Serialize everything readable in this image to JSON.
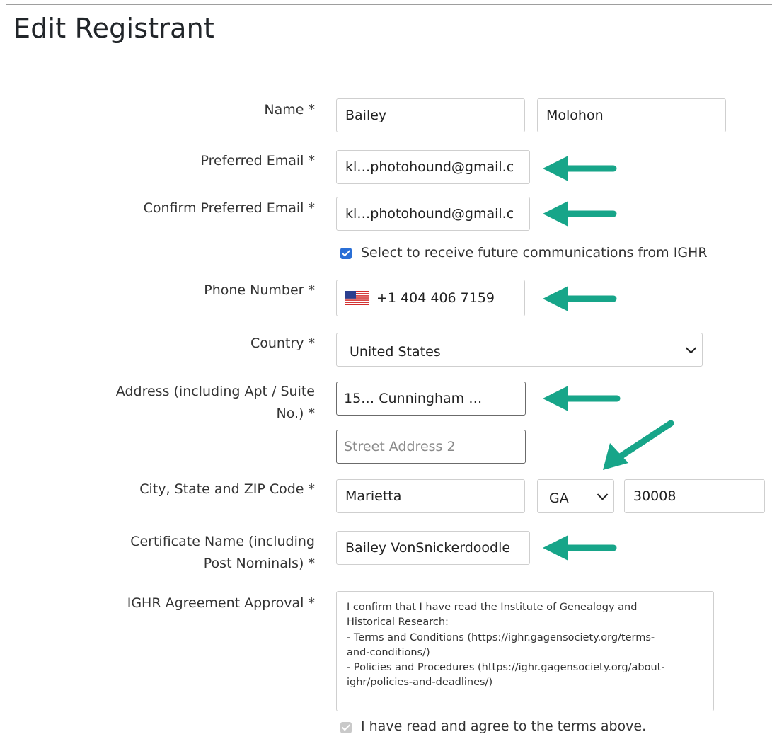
{
  "page": {
    "title": "Edit Registrant"
  },
  "form": {
    "name": {
      "label": "Name  *",
      "first_value": "Bailey",
      "last_value": "Molohon"
    },
    "preferred_email": {
      "label": "Preferred Email  *",
      "value": "kl…photohound@gmail.c"
    },
    "confirm_email": {
      "label": "Confirm Preferred Email  *",
      "value": "kl…photohound@gmail.c"
    },
    "communications": {
      "label": "Select to receive future communications from IGHR",
      "checked": true
    },
    "phone": {
      "label": "Phone Number  *",
      "value": "+1 404 406 7159",
      "flag_icon": "us-flag-icon"
    },
    "country": {
      "label": "Country  *",
      "value": "United States"
    },
    "address": {
      "label_line1": "Address (including Apt / Suite",
      "label_line2": "No.)  *",
      "line1_value": "15… Cunningham …",
      "line2_placeholder": "Street Address 2"
    },
    "city_state_zip": {
      "label": "City, State and ZIP Code  *",
      "city_value": "Marietta",
      "state_value": "GA",
      "zip_value": "30008"
    },
    "certificate_name": {
      "label_line1": "Certificate Name (including",
      "label_line2": "Post Nominals)  *",
      "value": "Bailey VonSnickerdoodle"
    },
    "agreement": {
      "label": "IGHR Agreement Approval  *",
      "lines": [
        "I confirm that I have read the Institute of Genealogy and",
        "Historical Research:",
        "- Terms and Conditions (https://ighr.gagensociety.org/terms-",
        "and-conditions/)",
        "- Policies and Procedures (https://ighr.gagensociety.org/about-",
        "ighr/policies-and-deadlines/)"
      ],
      "checkbox_label": "I have read and agree to the terms above.",
      "checked": true
    }
  },
  "annotations": {
    "arrow_color": "#17a589"
  }
}
